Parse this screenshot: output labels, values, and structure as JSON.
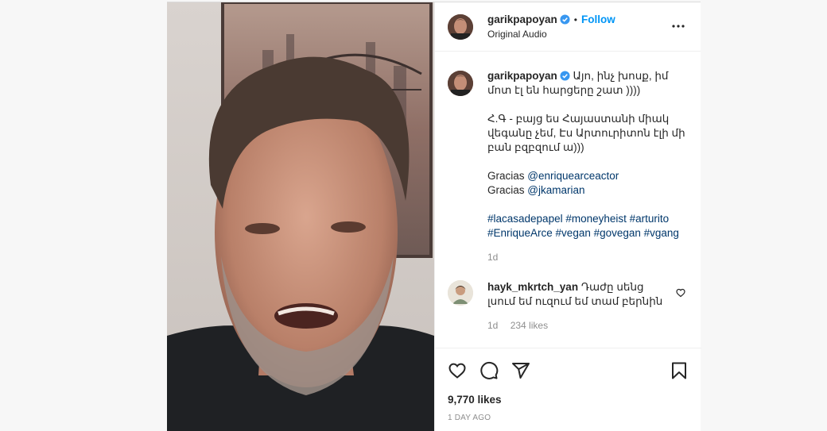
{
  "post": {
    "username": "garikpapoyan",
    "follow_label": "Follow",
    "separator": "•",
    "audio": "Original Audio"
  },
  "caption": {
    "username": "garikpapoyan",
    "line1": "Այո, ինչ խոսք, իմ մոտ էլ են հարցերը շատ ))))",
    "line2": "Հ.Գ - բայց ես Հայաստանի միակ վեգանը չեմ, Էս Արտուրիտոն էլի մի բան բզբզում ա)))",
    "gracias1_prefix": "Gracias ",
    "gracias1_mention": "@enriquearceactor",
    "gracias2_prefix": "Gracias ",
    "gracias2_mention": "@jkamarian",
    "hashtags_line1": "#lacasadepapel #moneyheist #arturito",
    "hashtags_line2": "#EnriqueArce #vegan #govegan #vgang",
    "time": "1d"
  },
  "comment": {
    "username": "hayk_mkrtch_yan",
    "text": "Դաժը սենց լսում եմ ուզում եմ տամ բերնին",
    "time": "1d",
    "likes": "234 likes"
  },
  "footer": {
    "likes": "9,770 likes",
    "ago": "1 DAY AGO"
  },
  "icons": {
    "like": "heart-icon",
    "comment": "comment-icon",
    "share": "share-icon",
    "save": "bookmark-icon",
    "more": "more-options-icon",
    "verified": "verified-badge-icon"
  },
  "colors": {
    "accent": "#0095f6",
    "verified": "#3897f0",
    "link": "#00376b",
    "muted": "#8e8e8e"
  }
}
